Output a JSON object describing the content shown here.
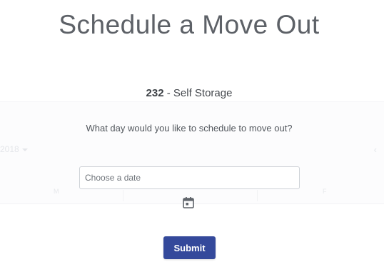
{
  "page": {
    "title": "Schedule a Move Out"
  },
  "unit": {
    "number": "232",
    "separator": " - ",
    "name": "Self Storage"
  },
  "question": "What day would you like to schedule to move out?",
  "date_field": {
    "placeholder": "Choose a date",
    "value": ""
  },
  "calendar_icon": "calendar-icon",
  "submit_label": "Submit",
  "background_calendar": {
    "year_text": "2018",
    "prev_icon": "chevron-left-icon",
    "day_heads": [
      "M",
      "F"
    ]
  },
  "colors": {
    "primary_button": "#34499b",
    "title_text": "#5d6167",
    "input_border": "#cfd3d8"
  }
}
